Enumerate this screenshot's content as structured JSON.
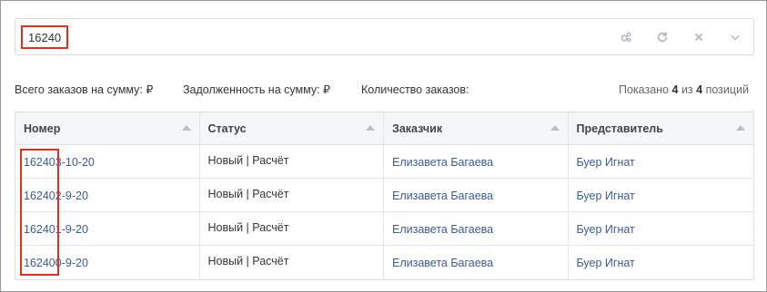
{
  "search": {
    "value": "16240"
  },
  "toolbar": {
    "icons": [
      "settings-icon",
      "refresh-icon",
      "clear-icon",
      "chevron-down-icon"
    ]
  },
  "summary": {
    "total_orders": "Всего заказов на сумму: ₽",
    "debt": "Задолженность на сумму: ₽",
    "count": "Количество заказов:",
    "shown_prefix": "Показано",
    "shown_value": "4",
    "shown_middle": "из",
    "shown_total": "4",
    "shown_suffix": "позиций"
  },
  "table": {
    "headers": [
      "Номер",
      "Статус",
      "Заказчик",
      "Представитель"
    ],
    "rows": [
      {
        "number": "162403-10-20",
        "status": "Новый | Расчёт",
        "customer": "Елизавета Багаева",
        "rep": "Буер Игнат"
      },
      {
        "number": "162402-9-20",
        "status": "Новый | Расчёт",
        "customer": "Елизавета Багаева",
        "rep": "Буер Игнат"
      },
      {
        "number": "162401-9-20",
        "status": "Новый | Расчёт",
        "customer": "Елизавета Багаева",
        "rep": "Буер Игнат"
      },
      {
        "number": "162400-9-20",
        "status": "Новый | Расчёт",
        "customer": "Елизавета Багаева",
        "rep": "Буер Игнат"
      }
    ]
  },
  "colors": {
    "link": "#3a5a98",
    "highlight": "#e0301e",
    "header_bg": "#f4f6f8"
  }
}
